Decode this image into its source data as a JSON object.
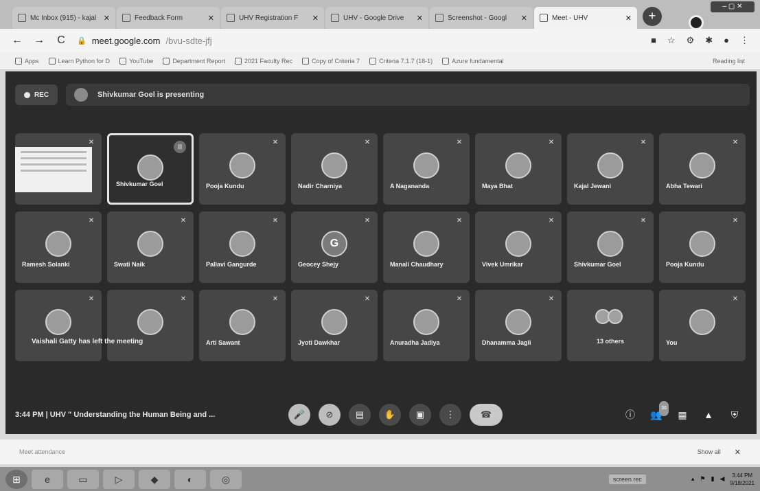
{
  "browser": {
    "tabs": [
      {
        "label": "Mc Inbox (915) - kajal",
        "active": false
      },
      {
        "label": "Feedback Form",
        "active": false
      },
      {
        "label": "UHV Registration F",
        "active": false
      },
      {
        "label": "UHV - Google Drive",
        "active": false
      },
      {
        "label": "Screenshot - Googl",
        "active": false
      },
      {
        "label": "Meet - UHV",
        "active": true
      }
    ],
    "new_tab_label": "+",
    "url_domain": "meet.google.com",
    "url_path": "/bvu-sdte-jfj",
    "bookmarks": [
      "Apps",
      "Learn Python for D",
      "YouTube",
      "Department Report",
      "2021 Faculty Rec",
      "Copy of Criteria 7",
      "Criteria 7.1.7 (18-1)",
      "Azure fundamental"
    ],
    "bookmarks_right": "Reading list"
  },
  "meet": {
    "rec_label": "REC",
    "presenting_text": "Shivkumar Goel is presenting",
    "tiles": [
      {
        "name": "",
        "kind": "share"
      },
      {
        "name": "Shivkumar Goel",
        "kind": "speaking"
      },
      {
        "name": "Pooja Kundu",
        "kind": "avatar"
      },
      {
        "name": "Nadir Charniya",
        "kind": "avatar"
      },
      {
        "name": "A Nagananda",
        "kind": "avatar"
      },
      {
        "name": "Maya Bhat",
        "kind": "avatar"
      },
      {
        "name": "Kajal Jewani",
        "kind": "avatar"
      },
      {
        "name": "Abha Tewari",
        "kind": "avatar"
      },
      {
        "name": "Ramesh Solanki",
        "kind": "avatar"
      },
      {
        "name": "Swati Naik",
        "kind": "avatar"
      },
      {
        "name": "Pallavi Gangurde",
        "kind": "avatar"
      },
      {
        "name": "Geocey Shejy",
        "kind": "letter",
        "letter": "G"
      },
      {
        "name": "Manali Chaudhary",
        "kind": "avatar"
      },
      {
        "name": "Vivek Umrikar",
        "kind": "avatar"
      },
      {
        "name": "Shivkumar Goel",
        "kind": "avatar"
      },
      {
        "name": "Pooja Kundu",
        "kind": "avatar"
      },
      {
        "name": "",
        "kind": "avatar"
      },
      {
        "name": "",
        "kind": "avatar"
      },
      {
        "name": "Arti Sawant",
        "kind": "avatar"
      },
      {
        "name": "Jyoti Dawkhar",
        "kind": "avatar"
      },
      {
        "name": "Anuradha Jadiya",
        "kind": "avatar"
      },
      {
        "name": "Dhanamma Jagli",
        "kind": "avatar"
      },
      {
        "name": "13 others",
        "kind": "others"
      },
      {
        "name": "You",
        "kind": "avatar"
      }
    ],
    "left_message": "Vaishali Gatty has left the meeting",
    "time": "3:44 PM",
    "meeting_title": "UHV \" Understanding the Human Being and ...",
    "participant_count": "36"
  },
  "downloads": {
    "item": "Meet attendance",
    "show_all": "Show all"
  },
  "taskbar": {
    "middle_label": "screen rec",
    "clock_time": "3:44 PM",
    "clock_date": "9/18/2021"
  }
}
